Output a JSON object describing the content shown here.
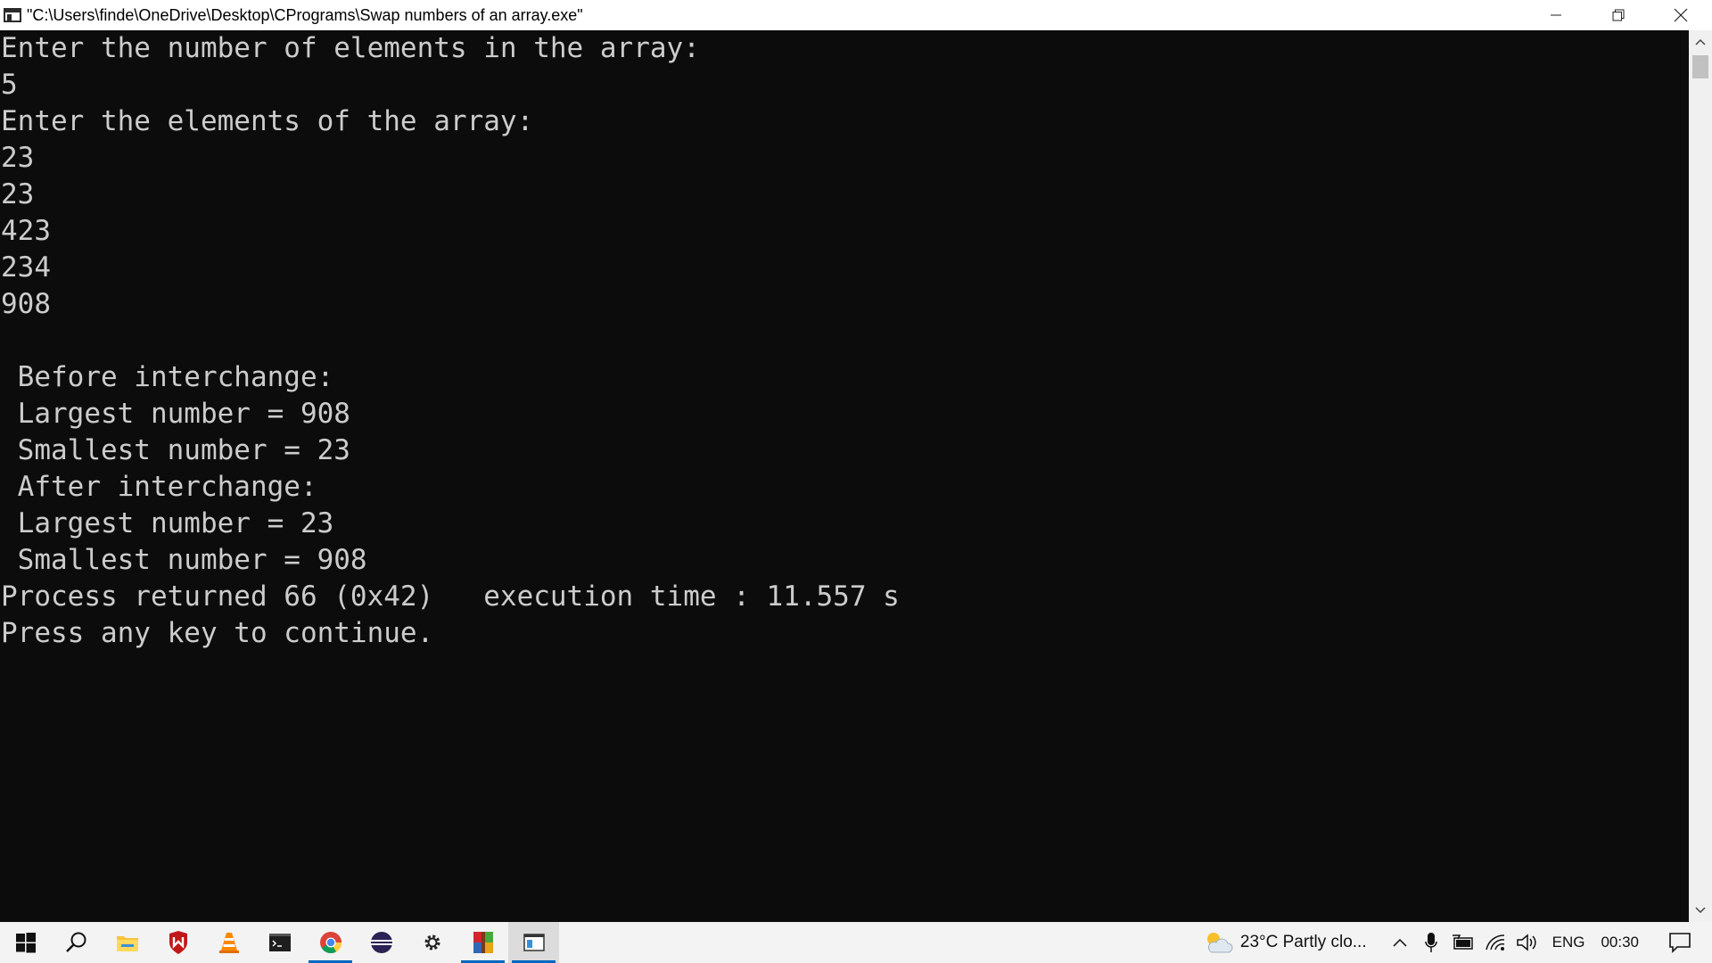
{
  "window": {
    "title": "\"C:\\Users\\finde\\OneDrive\\Desktop\\CPrograms\\Swap numbers of an array.exe\"",
    "controls": [
      "minimize-icon",
      "restore-icon",
      "close-icon"
    ]
  },
  "console": {
    "lines": [
      "Enter the number of elements in the array:",
      "5",
      "Enter the elements of the array:",
      "23",
      "23",
      "423",
      "234",
      "908",
      "",
      " Before interchange:",
      " Largest number = 908",
      " Smallest number = 23",
      " After interchange:",
      " Largest number = 23",
      " Smallest number = 908",
      "Process returned 66 (0x42)   execution time : 11.557 s",
      "Press any key to continue."
    ],
    "background": "#0c0c0c",
    "foreground": "#cccccc"
  },
  "taskbar": {
    "icons": [
      "start-icon",
      "search-icon",
      "file-explorer-icon",
      "mcafee-icon",
      "vlc-icon",
      "terminal-icon",
      "chrome-icon",
      "eclipse-icon",
      "settings-icon",
      "winrar-icon",
      "console-app-icon"
    ],
    "weather": "23°C  Partly clo...",
    "language": "ENG",
    "time": "00:30"
  }
}
